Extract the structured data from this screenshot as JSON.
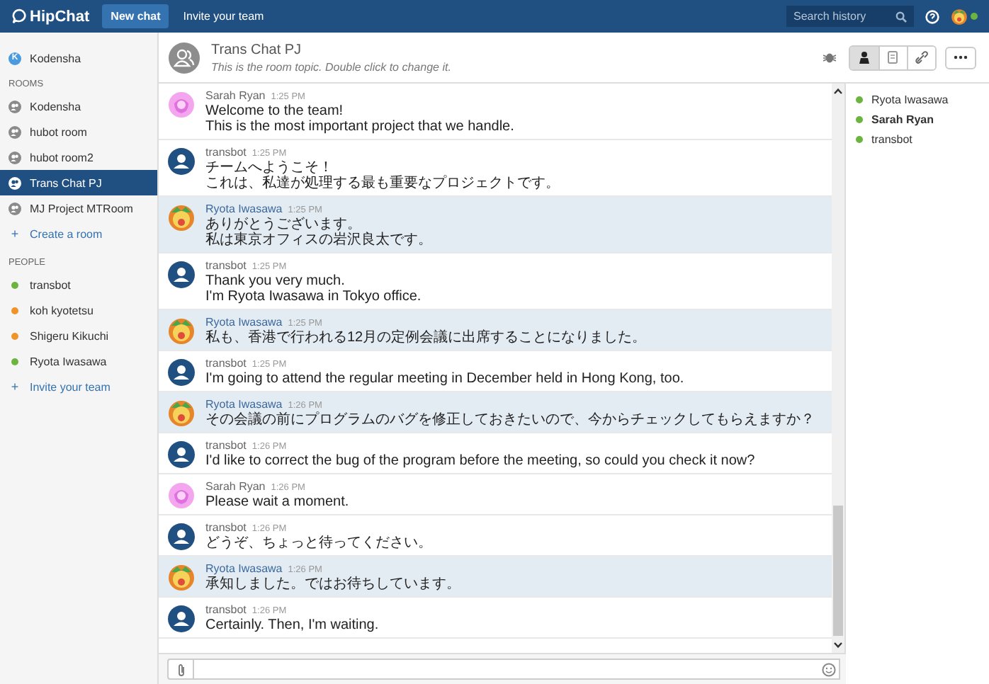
{
  "topbar": {
    "logo": "HipChat",
    "tabs": [
      {
        "label": "New chat",
        "selected": true
      },
      {
        "label": "Invite your team",
        "selected": false
      }
    ],
    "search": {
      "placeholder": "Search history"
    },
    "presence": {
      "color": "#6cb33f"
    }
  },
  "sidebar": {
    "account": {
      "badge": "K",
      "label": "Kodensha"
    },
    "rooms_heading": "ROOMS",
    "rooms": [
      {
        "label": "Kodensha",
        "selected": false
      },
      {
        "label": "hubot room",
        "selected": false
      },
      {
        "label": "hubot room2",
        "selected": false
      },
      {
        "label": "Trans Chat PJ",
        "selected": true
      },
      {
        "label": "MJ Project MTRoom",
        "selected": false
      }
    ],
    "create_room": {
      "symbol": "+",
      "label": "Create a room"
    },
    "people_heading": "PEOPLE",
    "people": [
      {
        "label": "transbot",
        "color": "#6cb33f"
      },
      {
        "label": "koh kyotetsu",
        "color": "#f0932b"
      },
      {
        "label": "Shigeru Kikuchi",
        "color": "#f0932b"
      },
      {
        "label": "Ryota Iwasawa",
        "color": "#6cb33f"
      }
    ],
    "invite": {
      "symbol": "+",
      "label": "Invite your team"
    }
  },
  "room": {
    "title": "Trans Chat PJ",
    "topic": "This is the room topic. Double click to change it.",
    "views": [
      {
        "kind": "people",
        "selected": true
      },
      {
        "kind": "files",
        "selected": false
      },
      {
        "kind": "links",
        "selected": false
      }
    ]
  },
  "messages": [
    {
      "kind": "pink",
      "name": "Sarah Ryan",
      "time": "1:25 PM",
      "highlighted": false,
      "lines": [
        "Welcome to the team!",
        "This is the most important project that we handle."
      ]
    },
    {
      "kind": "bot",
      "name": "transbot",
      "time": "1:25 PM",
      "highlighted": false,
      "lines": [
        "チームへようこそ！",
        "これは、私達が処理する最も重要なプロジェクトです。"
      ]
    },
    {
      "kind": "lion",
      "name": "Ryota Iwasawa",
      "time": "1:25 PM",
      "highlighted": true,
      "lines": [
        "ありがとうございます。",
        "私は東京オフィスの岩沢良太です。"
      ]
    },
    {
      "kind": "bot",
      "name": "transbot",
      "time": "1:25 PM",
      "highlighted": false,
      "lines": [
        "Thank you very much.",
        "I'm Ryota Iwasawa in Tokyo office."
      ]
    },
    {
      "kind": "lion",
      "name": "Ryota Iwasawa",
      "time": "1:25 PM",
      "highlighted": true,
      "lines": [
        "私も、香港で行われる12月の定例会議に出席することになりました。"
      ]
    },
    {
      "kind": "bot",
      "name": "transbot",
      "time": "1:25 PM",
      "highlighted": false,
      "lines": [
        "I'm going to attend the regular meeting in December held in Hong Kong, too."
      ]
    },
    {
      "kind": "lion",
      "name": "Ryota Iwasawa",
      "time": "1:26 PM",
      "highlighted": true,
      "lines": [
        "その会議の前にプログラムのバグを修正しておきたいので、今からチェックしてもらえますか？"
      ]
    },
    {
      "kind": "bot",
      "name": "transbot",
      "time": "1:26 PM",
      "highlighted": false,
      "lines": [
        "I'd like to correct the bug of the program before the meeting, so could you check it now?"
      ]
    },
    {
      "kind": "pink",
      "name": "Sarah Ryan",
      "time": "1:26 PM",
      "highlighted": false,
      "lines": [
        "Please wait a moment."
      ]
    },
    {
      "kind": "bot",
      "name": "transbot",
      "time": "1:26 PM",
      "highlighted": false,
      "lines": [
        "どうぞ、ちょっと待ってください。"
      ]
    },
    {
      "kind": "lion",
      "name": "Ryota Iwasawa",
      "time": "1:26 PM",
      "highlighted": true,
      "lines": [
        "承知しました。ではお待ちしています。"
      ]
    },
    {
      "kind": "bot",
      "name": "transbot",
      "time": "1:26 PM",
      "highlighted": false,
      "lines": [
        "Certainly. Then, I'm waiting."
      ]
    }
  ],
  "members": [
    {
      "name": "Ryota Iwasawa",
      "color": "#6cb33f",
      "emphasized": false
    },
    {
      "name": "Sarah Ryan",
      "color": "#6cb33f",
      "emphasized": true
    },
    {
      "name": "transbot",
      "color": "#6cb33f",
      "emphasized": false
    }
  ]
}
